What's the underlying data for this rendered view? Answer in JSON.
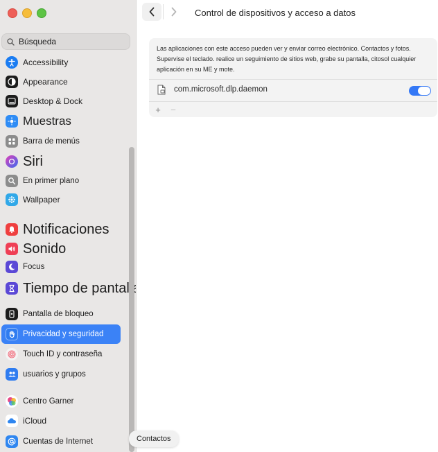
{
  "window": {
    "title": "Control de dispositivos y acceso a datos"
  },
  "sidebar": {
    "search_placeholder": "Búsqueda",
    "items": [
      {
        "label": "Accessibility",
        "icon": "accessibility-icon",
        "color": "#1a7cf2"
      },
      {
        "label": "Appearance",
        "icon": "appearance-icon",
        "color": "#1c1c1c"
      },
      {
        "label": "Desktop & Dock",
        "icon": "dock-icon",
        "color": "#1c1c1c"
      },
      {
        "label": "Muestras",
        "icon": "displays-icon",
        "color": "#2f8cf5"
      },
      {
        "label": "Barra de menús",
        "icon": "menu-bar-icon",
        "color": "#8c8c8c"
      },
      {
        "label": "Siri",
        "icon": "siri-icon",
        "color": "#7a3cd8"
      },
      {
        "label": "En primer plano",
        "icon": "spotlight-icon",
        "color": "#8c8c8c"
      },
      {
        "label": "Wallpaper",
        "icon": "wallpaper-icon",
        "color": "#31a8e8"
      },
      {
        "label": "Notificaciones",
        "icon": "notifications-icon",
        "color": "#ef3f3f"
      },
      {
        "label": "Sonido",
        "icon": "sound-icon",
        "color": "#ef3f55"
      },
      {
        "label": "Focus",
        "icon": "focus-icon",
        "color": "#5b48d6"
      },
      {
        "label": "Tiempo de pantalla",
        "icon": "screen-time-icon",
        "color": "#5b48d6"
      },
      {
        "label": "Pantalla de bloqueo",
        "icon": "lock-screen-icon",
        "color": "#1c1c1c"
      },
      {
        "label": "Privacidad y seguridad",
        "icon": "privacy-hand-icon",
        "color": "#2f7cf0"
      },
      {
        "label": "Touch ID y contraseña",
        "icon": "touch-id-icon",
        "color": "#f26a7a"
      },
      {
        "label": "usuarios y grupos",
        "icon": "users-icon",
        "color": "#2f7cf0"
      },
      {
        "label": "Centro Garner",
        "icon": "game-center-icon",
        "color": "#e84a88"
      },
      {
        "label": "iCloud",
        "icon": "icloud-icon",
        "color": "#2f86f0"
      },
      {
        "label": "Cuentas de Internet",
        "icon": "internet-accounts-icon",
        "color": "#2f86f0"
      }
    ]
  },
  "panel": {
    "description": "Las aplicaciones con este acceso pueden ver y enviar correo electrónico. Contactos y fotos. Supervise el teclado. realice un seguimiento de sitios web, grabe su pantalla, citosol cualquier aplicación en su ME y mote.",
    "app_name": "com.microsoft.dlp.daemon",
    "toggle_on": true,
    "plus_label": "+",
    "minus_label": "−"
  },
  "tooltip": {
    "label": "Contactos"
  },
  "colors": {
    "accent": "#3478f6",
    "selected_item": "#3b82f6"
  }
}
